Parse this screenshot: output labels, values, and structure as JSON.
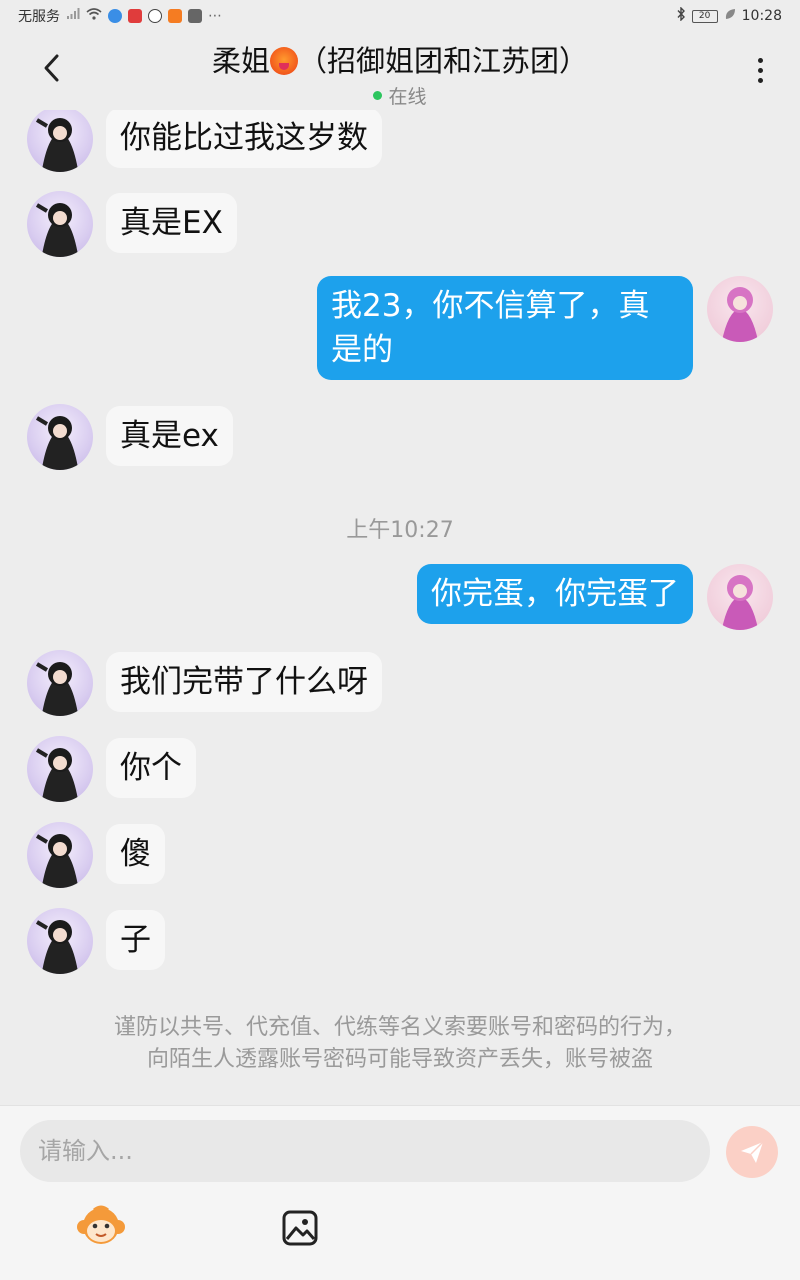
{
  "status_bar": {
    "carrier": "无服务",
    "time": "10:28",
    "battery": "20"
  },
  "header": {
    "title_prefix": "柔姐",
    "title_suffix": "（招御姐团和江苏团）",
    "status": "在线",
    "title_emoji": "hot-face-emoji",
    "back_icon": "chevron-left-icon",
    "more_icon": "more-vertical-icon"
  },
  "messages": [
    {
      "from": "other",
      "text": "你能比过我这岁数"
    },
    {
      "from": "other",
      "text": "真是EX"
    },
    {
      "from": "self",
      "text": "我23，你不信算了，真\n是的"
    },
    {
      "from": "other",
      "text": "真是ex"
    },
    {
      "from": "self",
      "text": "你完蛋，你完蛋了"
    },
    {
      "from": "other",
      "text": "我们完带了什么呀"
    },
    {
      "from": "other",
      "text": "你个"
    },
    {
      "from": "other",
      "text": "傻"
    },
    {
      "from": "other",
      "text": "子"
    }
  ],
  "timestamp": "上午10:27",
  "notice": {
    "line1": "谨防以共号、代充值、代练等名义索要账号和密码的行为，",
    "line2": "向陌生人透露账号密码可能导致资产丢失，账号被盗"
  },
  "composer": {
    "placeholder": "请输入...",
    "send_icon": "send-icon",
    "emoji_icon": "monkey-face-icon",
    "image_icon": "image-icon"
  },
  "colors": {
    "self_bubble": "#1da1ec",
    "other_bubble": "#f7f7f7",
    "online_dot": "#2dc55e",
    "send_button": "#fbd0c6"
  }
}
